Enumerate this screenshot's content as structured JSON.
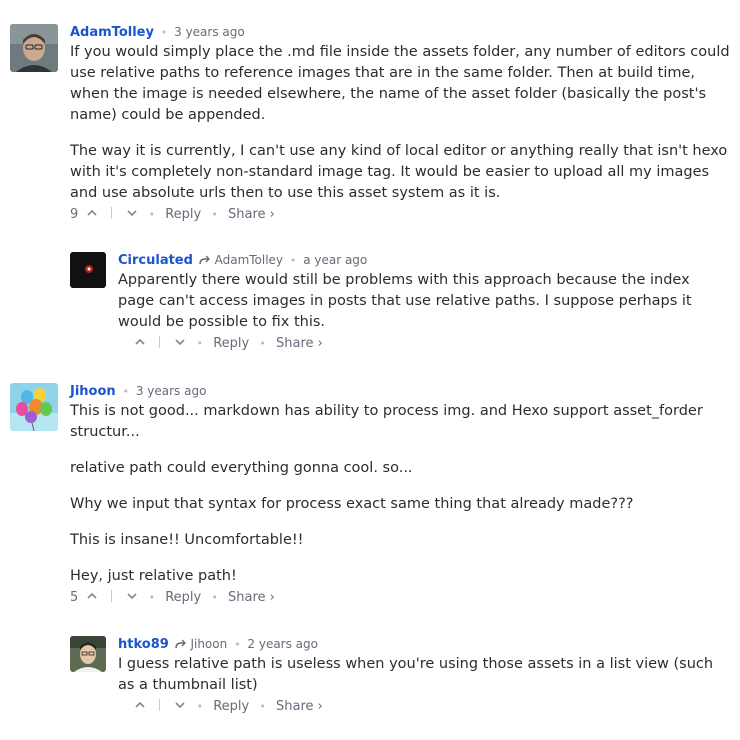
{
  "comments": [
    {
      "author": "AdamTolley",
      "time": "3 years ago",
      "paragraphs": [
        "If you would simply place the .md file inside the assets folder, any number of editors could use relative paths to reference images that are in the same folder. Then at build time, when the image is needed elsewhere, the name of the asset folder (basically the post's name) could be appended.",
        "The way it is currently, I can't use any kind of local editor or anything really that isn't hexo with it's completely non-standard image tag. It would be easier to upload all my images and use absolute urls then to use this asset system as it is."
      ],
      "votes": "9",
      "reply_label": "Reply",
      "share_label": "Share ›"
    },
    {
      "author": "Circulated",
      "reply_to": "AdamTolley",
      "time": "a year ago",
      "paragraphs": [
        "Apparently there would still be problems with this approach because the index page can't access images in posts that use relative paths. I suppose perhaps it would be possible to fix this."
      ],
      "votes": "",
      "reply_label": "Reply",
      "share_label": "Share ›"
    },
    {
      "author": "Jihoon",
      "time": "3 years ago",
      "paragraphs": [
        "This is not good... markdown has ability to process img. and Hexo support asset_forder structur...",
        "relative path could everything gonna cool. so...",
        "Why we input that syntax for process exact same thing that already made???",
        "This is insane!! Uncomfortable!!",
        "Hey, just relative path!"
      ],
      "votes": "5",
      "reply_label": "Reply",
      "share_label": "Share ›"
    },
    {
      "author": "htko89",
      "reply_to": "Jihoon",
      "time": "2 years ago",
      "paragraphs": [
        "I guess relative path is useless when you're using those assets in a list view (such as a thumbnail list)"
      ],
      "votes": "",
      "reply_label": "Reply",
      "share_label": "Share ›"
    }
  ],
  "separator": "•",
  "icons": {
    "upvote": "chevron-up-icon",
    "downvote": "chevron-down-icon",
    "reply_to": "reply-arrow-icon"
  },
  "colors": {
    "author": "#1a55cc",
    "meta": "#656c7a",
    "text": "#2a2e2e"
  }
}
